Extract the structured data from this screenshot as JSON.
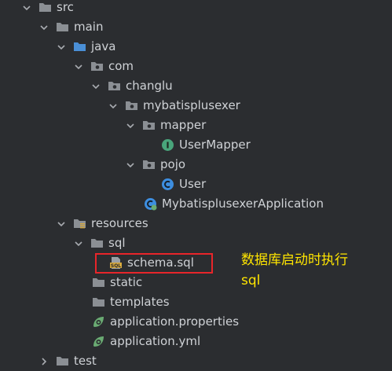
{
  "tree": {
    "src": "src",
    "main": "main",
    "java": "java",
    "com": "com",
    "changlu": "changlu",
    "pkg": "mybatisplusexer",
    "mapper": "mapper",
    "user_mapper": "UserMapper",
    "pojo": "pojo",
    "user": "User",
    "app_class": "MybatisplusexerApplication",
    "resources": "resources",
    "sql": "sql",
    "schema": "schema.sql",
    "static": "static",
    "templates": "templates",
    "app_props": "application.properties",
    "app_yml": "application.yml",
    "test": "test"
  },
  "annotation": {
    "line1": "数据库启动时执行",
    "line2": "sql"
  },
  "colors": {
    "background": "#2b2d30",
    "text": "#cfd2d6",
    "folder": "#8b8f94",
    "source_folder": "#4a8fd6",
    "interface_icon": "#49a57b",
    "class_icon": "#3d8ee0",
    "spring_icon": "#6aab73",
    "highlight": "#e8252a",
    "annotation": "#ffe500"
  }
}
